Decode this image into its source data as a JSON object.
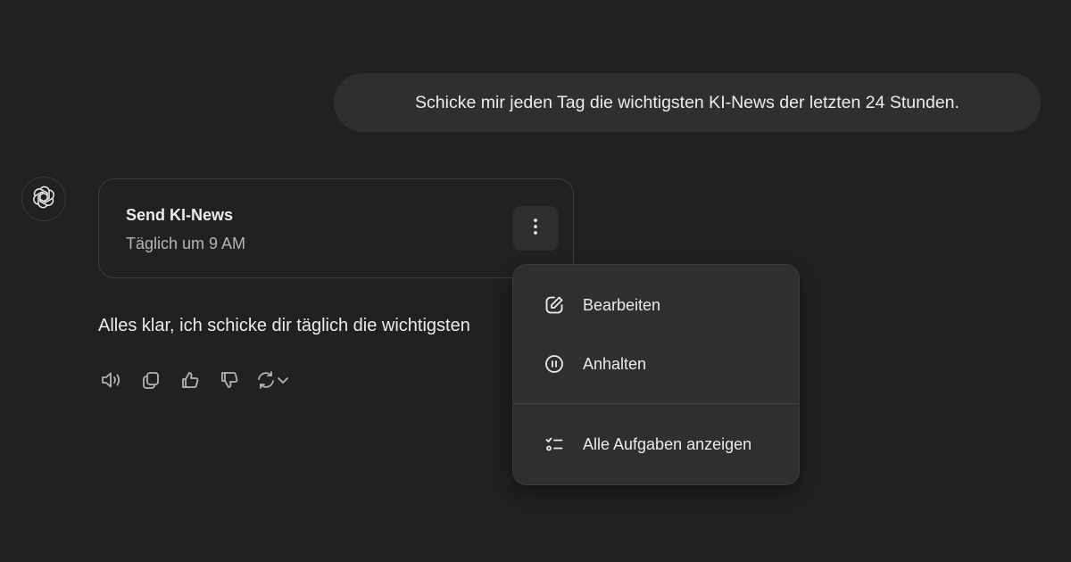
{
  "user_message": "Schicke mir jeden Tag die wichtigsten KI-News der letzten 24 Stunden.",
  "assistant": {
    "avatar_icon": "openai-logo-icon",
    "task_card": {
      "title": "Send KI-News",
      "schedule": "Täglich um 9 AM",
      "more_icon": "vertical-ellipsis-icon"
    },
    "reply": "Alles klar, ich schicke dir täglich die wichtigsten",
    "actions": [
      {
        "name": "read-aloud-icon"
      },
      {
        "name": "copy-icon"
      },
      {
        "name": "thumbs-up-icon"
      },
      {
        "name": "thumbs-down-icon"
      },
      {
        "name": "regenerate-icon"
      },
      {
        "name": "chevron-down-icon"
      }
    ]
  },
  "menu": {
    "items": [
      {
        "label": "Bearbeiten",
        "icon": "edit-icon"
      },
      {
        "label": "Anhalten",
        "icon": "pause-icon"
      },
      {
        "label": "Alle Aufgaben anzeigen",
        "icon": "task-list-icon"
      }
    ]
  },
  "colors": {
    "background": "#212121",
    "bubble": "#2f2f2f",
    "text": "#ececec",
    "muted": "#b4b4b4"
  }
}
